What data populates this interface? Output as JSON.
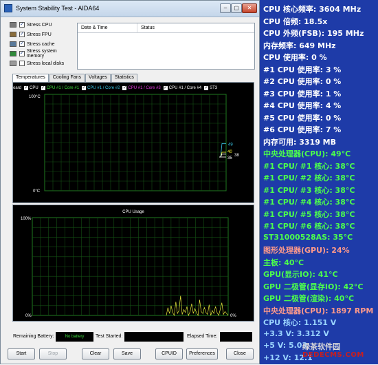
{
  "window": {
    "title": "System Stability Test - AIDA64",
    "controls": {
      "minimize": "–",
      "maximize": "▢",
      "close": "✕"
    }
  },
  "stress": [
    {
      "label": "Stress CPU",
      "checked": true,
      "device": "cpu-chip-icon",
      "color": "#7a7a7a"
    },
    {
      "label": "Stress FPU",
      "checked": true,
      "device": "fpu-chip-icon",
      "color": "#8a6d3b"
    },
    {
      "label": "Stress cache",
      "checked": true,
      "device": "cache-chip-icon",
      "color": "#5a7a9a"
    },
    {
      "label": "Stress system memory",
      "checked": true,
      "device": "memory-module-icon",
      "color": "#2f8a3a"
    },
    {
      "label": "Stress local disks",
      "checked": false,
      "device": "disk-drive-icon",
      "color": "#9a9a9a"
    }
  ],
  "log": {
    "col_date": "Date & Time",
    "col_status": "Status"
  },
  "tabs": [
    "Temperatures",
    "Cooling Fans",
    "Voltages",
    "Statistics"
  ],
  "temp_legend": [
    {
      "label": "oard",
      "color": "#ffffff",
      "checkbox": false
    },
    {
      "label": "CPU",
      "color": "#ffffff",
      "checkbox": true
    },
    {
      "label": "CPU #1 / Core #1",
      "color": "#3ddc3d",
      "checkbox": true
    },
    {
      "label": "CPU #1 / Core #2",
      "color": "#39c6e6",
      "checkbox": true
    },
    {
      "label": "CPU #1 / Core #3",
      "color": "#e63ce6",
      "checkbox": true
    },
    {
      "label": "CPU #1 / Core #4",
      "color": "#ffffff",
      "checkbox": true
    },
    {
      "label": "ST3",
      "color": "#ffffff",
      "checkbox": true
    }
  ],
  "chart_data": [
    {
      "type": "line",
      "title": "",
      "ylim": [
        0,
        100
      ],
      "y_top_label": "100°C",
      "y_bottom_label": "0°C",
      "grid": true,
      "end_labels": [
        {
          "value": "49",
          "color": "#39c6e6"
        },
        {
          "value": "40",
          "color": "#ffff33"
        },
        {
          "value": "38",
          "color": "#ffffff"
        },
        {
          "value": "35",
          "color": "#ffffff"
        }
      ],
      "series": [
        {
          "color": "#39c6e6",
          "values": [
            35,
            35,
            49,
            49,
            49,
            49
          ]
        },
        {
          "color": "#ffff33",
          "values": [
            35,
            35,
            40,
            40,
            40,
            40
          ]
        },
        {
          "color": "#ffffff",
          "values": [
            35,
            35,
            38,
            38,
            38,
            38
          ]
        },
        {
          "color": "#ffffff",
          "values": [
            35,
            35,
            35,
            35,
            35,
            35
          ]
        }
      ]
    },
    {
      "type": "line",
      "title": "CPU Usage",
      "ylim": [
        0,
        100
      ],
      "y_top_label": "100%",
      "y_bottom_label": "0%",
      "end_label": "0%",
      "grid": true,
      "series": [
        {
          "color": "#e6e63c",
          "values": [
            0,
            8,
            2,
            10,
            3,
            0,
            14,
            2,
            5,
            20,
            1,
            6,
            3,
            9,
            0,
            4,
            12,
            2,
            7,
            3,
            0,
            16,
            4,
            2,
            8,
            3,
            1,
            11,
            0,
            5,
            2,
            9,
            3,
            0,
            6,
            13,
            1,
            4,
            2,
            0
          ]
        }
      ]
    }
  ],
  "status": {
    "remaining_battery_label": "Remaining Battery:",
    "battery_value": "No battery",
    "test_started_label": "Test Started:",
    "elapsed_label": "Elapsed Time:"
  },
  "buttons": {
    "start": "Start",
    "stop": "Stop",
    "clear": "Clear",
    "save": "Save",
    "cpuid": "CPUID",
    "preferences": "Preferences",
    "close": "Close"
  },
  "info_panel": {
    "background": "#1e3ba8",
    "rows": [
      {
        "text": "CPU 核心频率: 3604 MHz",
        "color": "#ffffff"
      },
      {
        "text": "CPU 倍频: 18.5x",
        "color": "#ffffff"
      },
      {
        "text": "CPU 外频(FSB): 195 MHz",
        "color": "#ffffff"
      },
      {
        "text": "内存频率: 649 MHz",
        "color": "#ffffff"
      },
      {
        "text": "CPU 使用率: 0 %",
        "color": "#ffffff"
      },
      {
        "text": "#1 CPU 使用率: 3 %",
        "color": "#ffffff"
      },
      {
        "text": "#2 CPU 使用率: 0 %",
        "color": "#ffffff"
      },
      {
        "text": "#3 CPU 使用率: 1 %",
        "color": "#ffffff"
      },
      {
        "text": "#4 CPU 使用率: 4 %",
        "color": "#ffffff"
      },
      {
        "text": "#5 CPU 使用率: 0 %",
        "color": "#ffffff"
      },
      {
        "text": "#6 CPU 使用率: 7 %",
        "color": "#ffffff"
      },
      {
        "text": "内存可用: 3319 MB",
        "color": "#ffffff"
      },
      {
        "text": "中央处理器(CPU): 49°C",
        "color": "#4cff4c"
      },
      {
        "text": "#1 CPU/ #1 核心: 38°C",
        "color": "#4cff4c"
      },
      {
        "text": "#1 CPU/ #2 核心: 38°C",
        "color": "#4cff4c"
      },
      {
        "text": "#1 CPU/ #3 核心: 38°C",
        "color": "#4cff4c"
      },
      {
        "text": "#1 CPU/ #4 核心: 38°C",
        "color": "#4cff4c"
      },
      {
        "text": "#1 CPU/ #5 核心: 38°C",
        "color": "#4cff4c"
      },
      {
        "text": "#1 CPU/ #6 核心: 38°C",
        "color": "#4cff4c"
      },
      {
        "text": "ST31000528AS: 35°C",
        "color": "#4cff4c"
      },
      {
        "text": "图形处理器(GPU): 24%",
        "color": "#ff9a8a"
      },
      {
        "text": "主板: 40°C",
        "color": "#4cff4c"
      },
      {
        "text": "GPU(显示IO): 41°C",
        "color": "#4cff4c"
      },
      {
        "text": "GPU 二极管(显存IO): 42°C",
        "color": "#4cff4c"
      },
      {
        "text": "GPU 二极管(渲染): 40°C",
        "color": "#4cff4c"
      },
      {
        "text": "中央处理器(CPU): 1897 RPM",
        "color": "#ff9a8a"
      },
      {
        "text": "CPU 核心: 1.151 V",
        "color": "#9ad4ff"
      },
      {
        "text": "+3.3 V: 3.312 V",
        "color": "#9ad4ff"
      },
      {
        "text": "+5 V: 5.03",
        "color": "#9ad4ff"
      },
      {
        "text": "+12 V: 12.1",
        "color": "#9ad4ff"
      }
    ]
  },
  "watermark": {
    "line1": "绿茶软件园",
    "line2": "DEDECMS.COM"
  }
}
